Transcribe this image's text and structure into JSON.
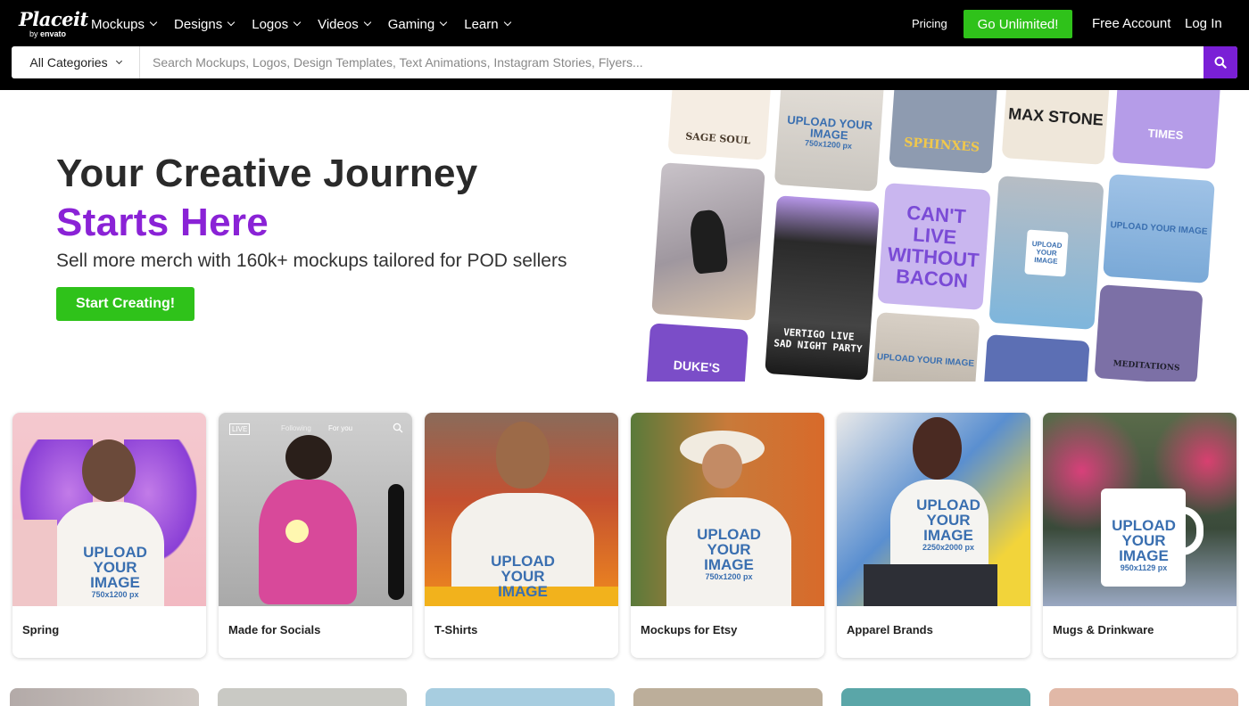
{
  "logo": {
    "main": "Placeit",
    "by": "by",
    "brand": "envato"
  },
  "nav": [
    {
      "label": "Mockups"
    },
    {
      "label": "Designs"
    },
    {
      "label": "Logos"
    },
    {
      "label": "Videos"
    },
    {
      "label": "Gaming"
    },
    {
      "label": "Learn"
    }
  ],
  "header": {
    "pricing": "Pricing",
    "unlimited": "Go Unlimited!",
    "free_account": "Free Account",
    "login": "Log In"
  },
  "search": {
    "category": "All Categories",
    "placeholder": "Search Mockups, Logos, Design Templates, Text Animations, Instagram Stories, Flyers..."
  },
  "hero": {
    "title_line1": "Your Creative Journey",
    "title_line2": "Starts Here",
    "subtitle": "Sell more merch with 160k+ mockups tailored for POD sellers",
    "cta": "Start Creating!"
  },
  "collage": {
    "sage_soul": "SAGE SOUL",
    "sphinxes": "SPHINXES",
    "max_stone": "MAX STONE",
    "times": "TIMES",
    "upload_image": "UPLOAD YOUR IMAGE",
    "upload_size": "750x1200 px",
    "bacon": "CAN'T LIVE WITHOUT BACON",
    "vertigo": "VERTIGO LIVE",
    "sad_night": "SAD NIGHT PARTY",
    "dukes": "DUKE'S",
    "meditations": "MEDITATIONS"
  },
  "cards": [
    {
      "label": "Spring",
      "print": "UPLOAD YOUR IMAGE",
      "size": "750x1200 px"
    },
    {
      "label": "Made for Socials",
      "following": "Following",
      "for_you": "For you",
      "live": "LIVE"
    },
    {
      "label": "T-Shirts",
      "print": "UPLOAD YOUR IMAGE",
      "size": ""
    },
    {
      "label": "Mockups for Etsy",
      "print": "UPLOAD YOUR IMAGE",
      "size": "750x1200 px"
    },
    {
      "label": "Apparel Brands",
      "print": "UPLOAD YOUR IMAGE",
      "size": "2250x2000 px"
    },
    {
      "label": "Mugs & Drinkware",
      "print": "UPLOAD YOUR IMAGE",
      "size": "950x1129 px"
    }
  ],
  "colors": {
    "accent_purple": "#8a22d6",
    "cta_green": "#2fc21a",
    "search_button": "#7a1fd6",
    "topbar": "#000000"
  }
}
